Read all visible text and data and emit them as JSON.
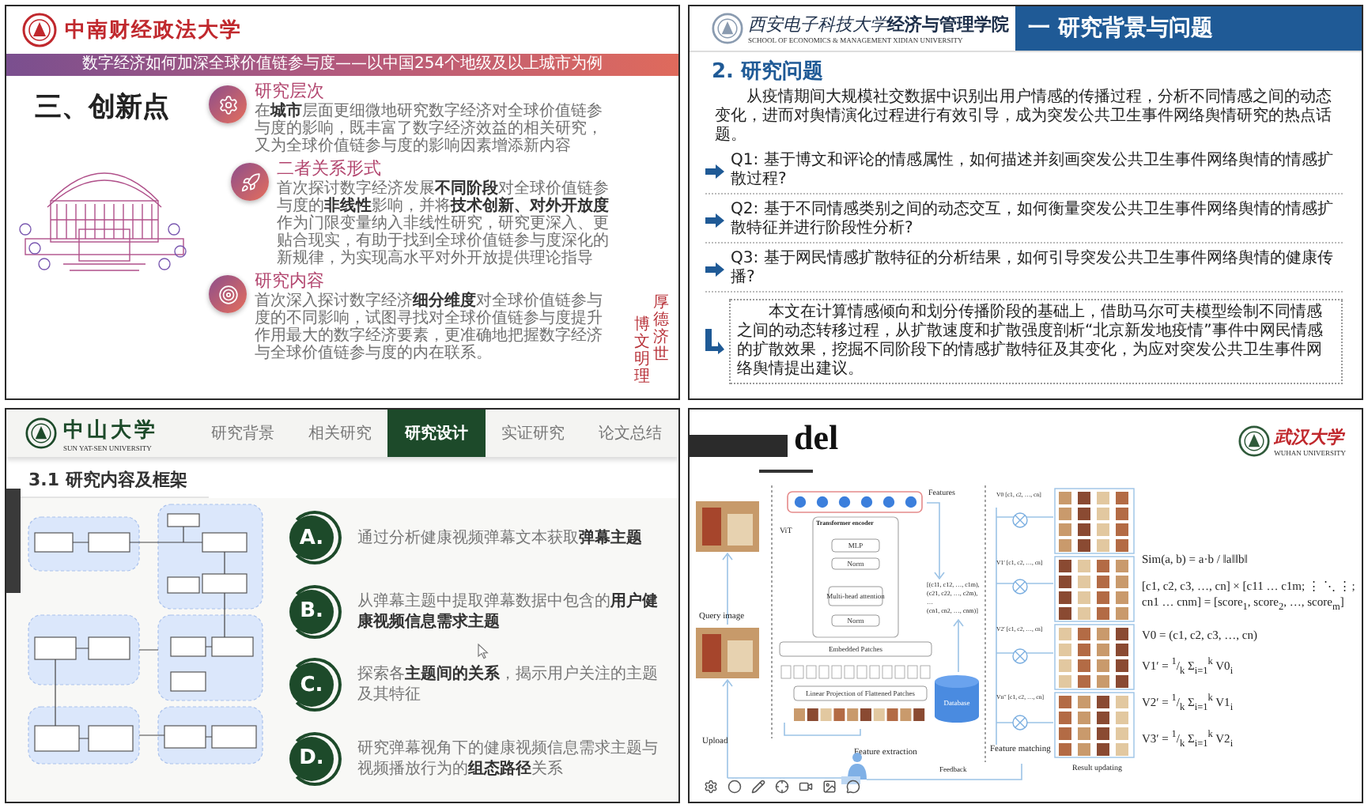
{
  "slide_top_left": {
    "logo_text": "中南财经政法大学",
    "banner": "数字经济如何加深全球价值链参与度——以中国254个地级及以上城市为例",
    "title": "三、创新点",
    "points": [
      {
        "kind": "gear",
        "heading": "研究层次",
        "text": "在**城市**层面更细微地研究数字经济对全球价值链参与度的影响，既丰富了数字经济效益的相关研究，又为全球价值链参与度的影响因素增添新内容"
      },
      {
        "kind": "rocket",
        "heading": "二者关系形式",
        "text": "首次探讨数字经济发展**不同阶段**对全球价值链参与度的**非线性**影响，并将**技术创新、对外开放度**作为门限变量纳入非线性研究，研究更深入、更贴合现实，有助于找到全球价值链参与度深化的新规律，为实现高水平对外开放提供理论指导"
      },
      {
        "kind": "target",
        "heading": "研究内容",
        "text": "首次深入探讨数字经济**细分维度**对全球价值链参与度的不同影响，试图寻找对全球价值链参与度提升作用最大的数字经济要素，更准确地把握数字经济与全球价值链参与度的内在联系。"
      }
    ],
    "motto": [
      "厚德济世",
      "博文明理"
    ]
  },
  "slide_top_right": {
    "school_name": "西安电子科技大学",
    "college_name": "经济与管理学院",
    "school_english": "SCHOOL OF ECONOMICS & MANAGEMENT XIDIAN UNIVERSITY",
    "section_title": "一 研究背景与问题",
    "heading": "2. 研究问题",
    "intro": "从疫情期间大规模社交数据中识别出用户情感的传播过程，分析不同情感之间的动态变化，进而对舆情演化过程进行有效引导，成为突发公共卫生事件网络舆情研究的热点话题。",
    "questions": [
      "Q1: 基于博文和评论的情感属性，如何描述并刻画突发公共卫生事件网络舆情的情感扩散过程?",
      "Q2: 基于不同情感类别之间的动态交互，如何衡量突发公共卫生事件网络舆情的情感扩散特征并进行阶段性分析?",
      "Q3: 基于网民情感扩散特征的分析结果，如何引导突发公共卫生事件网络舆情的健康传播?"
    ],
    "summary": "本文在计算情感倾向和划分传播阶段的基础上，借助马尔可夫模型绘制不同情感之间的动态转移过程，从扩散速度和扩散强度剖析“北京新发地疫情”事件中网民情感的扩散效果，挖掘不同阶段下的情感扩散特征及其变化，为应对突发公共卫生事件网络舆情提出建议。"
  },
  "slide_bottom_left": {
    "logo_text": "中山大学",
    "logo_english": "SUN YAT-SEN UNIVERSITY",
    "tabs": [
      {
        "label": "研究背景",
        "selected": false
      },
      {
        "label": "相关研究",
        "selected": false
      },
      {
        "label": "研究设计",
        "selected": true
      },
      {
        "label": "实证研究",
        "selected": false
      },
      {
        "label": "论文总结",
        "selected": false
      }
    ],
    "heading": "3.1 研究内容及框架",
    "steps": [
      {
        "letter": "A.",
        "text": "通过分析健康视频弹幕文本获取**弹幕主题**"
      },
      {
        "letter": "B.",
        "text": "从弹幕主题中提取弹幕数据中包含的**用户健康视频信息需求主题**"
      },
      {
        "letter": "C.",
        "text": "探索各**主题间的关系**，揭示用户关注的主题及其特征"
      },
      {
        "letter": "D.",
        "text": "研究弹幕视角下的健康视频信息需求主题与视频播放行为的**组态路径**关系"
      }
    ]
  },
  "slide_bottom_right": {
    "title_visible": "del",
    "logo_text": "武汉大学",
    "logo_english": "WUHAN UNIVERSITY",
    "diagram": {
      "features": "Features",
      "vit": "ViT",
      "encoder": "Transformer encoder",
      "mlp": "MLP",
      "norm_top": "Norm",
      "attention": "Multi-head attention",
      "norm_bottom": "Norm",
      "embedded": "Embedded Patches",
      "projection": "Linear Projection of Flattened Patches",
      "database": "Database",
      "matrix": [
        "[(c11, c12, …, c1m),",
        "(c21, c22, …, c2m),",
        "…",
        "(cn1, cn2, …, cnm)]"
      ],
      "vectors": [
        "V0 [c1, c2, …, cn]",
        "V1′ [c1, c2, …, cn]",
        "V2′ [c1, c2, …, cn]",
        "Vn′′ [c1, c2, …, cn]"
      ],
      "query": "Query image",
      "upload": "Upload",
      "extraction": "Feature extraction",
      "feedback": "Feedback",
      "matching": "Feature matching",
      "result": "Result updating"
    },
    "formulas": [
      "Sim(a, b) = a·b / ‖a‖‖b‖",
      "[c1, c2, c3, …, cn] × [c11 … c1m; ⋮ ⋱ ⋮; cn1 … cnm] = [score$_{1}$, score$_{2}$, …, score$_{m}$]",
      "V0 = (c1, c2, c3, …, cn)",
      "V1′ = $^{1}$/$_{k}$ Σ$_{i=1}$$^{k}$ V0$_{i}$",
      "V2′ = $^{1}$/$_{k}$ Σ$_{i=1}$$^{k}$ V1$_{i}$",
      "V3′ = $^{1}$/$_{k}$ Σ$_{i=1}$$^{k}$ V2$_{i}$"
    ]
  }
}
